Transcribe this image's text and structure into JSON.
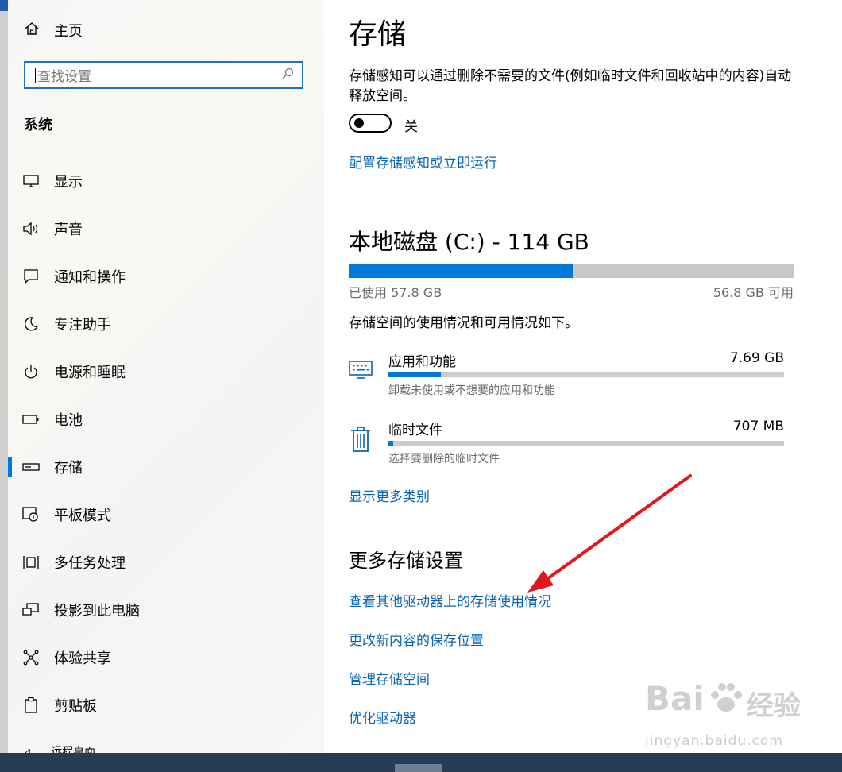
{
  "sidebar": {
    "home_label": "主页",
    "search_placeholder": "查找设置",
    "section_title": "系统",
    "items": [
      {
        "label": "显示",
        "icon": "monitor-icon"
      },
      {
        "label": "声音",
        "icon": "speaker-icon"
      },
      {
        "label": "通知和操作",
        "icon": "notification-icon"
      },
      {
        "label": "专注助手",
        "icon": "moon-icon"
      },
      {
        "label": "电源和睡眠",
        "icon": "power-icon"
      },
      {
        "label": "电池",
        "icon": "battery-icon"
      },
      {
        "label": "存储",
        "icon": "storage-icon",
        "active": true
      },
      {
        "label": "平板模式",
        "icon": "tablet-mode-icon"
      },
      {
        "label": "多任务处理",
        "icon": "multitask-icon"
      },
      {
        "label": "投影到此电脑",
        "icon": "project-icon"
      },
      {
        "label": "体验共享",
        "icon": "share-icon"
      },
      {
        "label": "剪贴板",
        "icon": "clipboard-icon"
      }
    ],
    "peek_label": "远程桌面"
  },
  "main": {
    "title": "存储",
    "description": "存储感知可以通过删除不需要的文件(例如临时文件和回收站中的内容)自动释放空间。",
    "toggle_state_label": "关",
    "configure_link": "配置存储感知或立即运行",
    "disk_title": "本地磁盘 (C:) - 114 GB",
    "disk_used_fraction": 0.504,
    "used_label": "已使用 57.8 GB",
    "available_label": "56.8 GB 可用",
    "usage_description": "存储空间的使用情况和可用情况如下。",
    "categories": [
      {
        "name": "应用和功能",
        "size": "7.69 GB",
        "subtitle": "卸载未使用或不想要的应用和功能",
        "fraction": 0.133,
        "icon": "keyboard-icon"
      },
      {
        "name": "临时文件",
        "size": "707 MB",
        "subtitle": "选择要删除的临时文件",
        "fraction": 0.012,
        "icon": "trash-icon"
      }
    ],
    "show_more_link": "显示更多类别",
    "more_settings_title": "更多存储设置",
    "more_links": [
      "查看其他驱动器上的存储使用情况",
      "更改新内容的保存位置",
      "管理存储空间",
      "优化驱动器"
    ]
  },
  "watermark": {
    "brand": "Bai",
    "brand_cn": "经验",
    "url": "jingyan.baidu.com"
  },
  "colors": {
    "accent": "#0078d7",
    "link": "#0a64b5",
    "annotation_arrow": "#e0161b"
  }
}
